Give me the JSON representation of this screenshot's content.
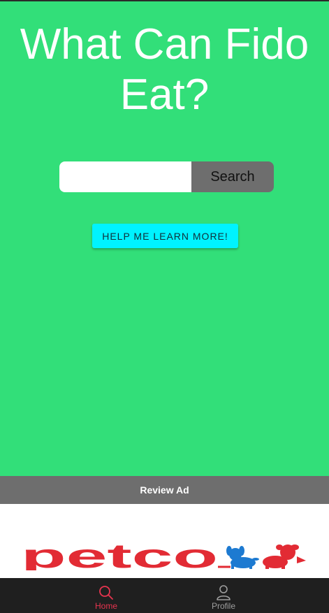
{
  "header": {
    "title": "What Can Fido Eat?"
  },
  "search": {
    "value": "",
    "placeholder": "",
    "button_label": "Search"
  },
  "learn_more": {
    "label": "HELP ME LEARN MORE!"
  },
  "ad": {
    "review_label": "Review Ad",
    "brand": "petco"
  },
  "tabs": [
    {
      "label": "Home",
      "icon": "search-icon",
      "active": true,
      "color": "#e8344f"
    },
    {
      "label": "Profile",
      "icon": "person-icon",
      "active": false,
      "color": "#9e9e9e"
    }
  ],
  "colors": {
    "background": "#32df79",
    "search_button": "#6e6e6e",
    "learn_button": "#00f3ff",
    "ad_bar": "#6e6e6e",
    "tab_bar": "#1f1f1f",
    "brand_red": "#e22b34",
    "brand_blue": "#1d7ad1"
  }
}
